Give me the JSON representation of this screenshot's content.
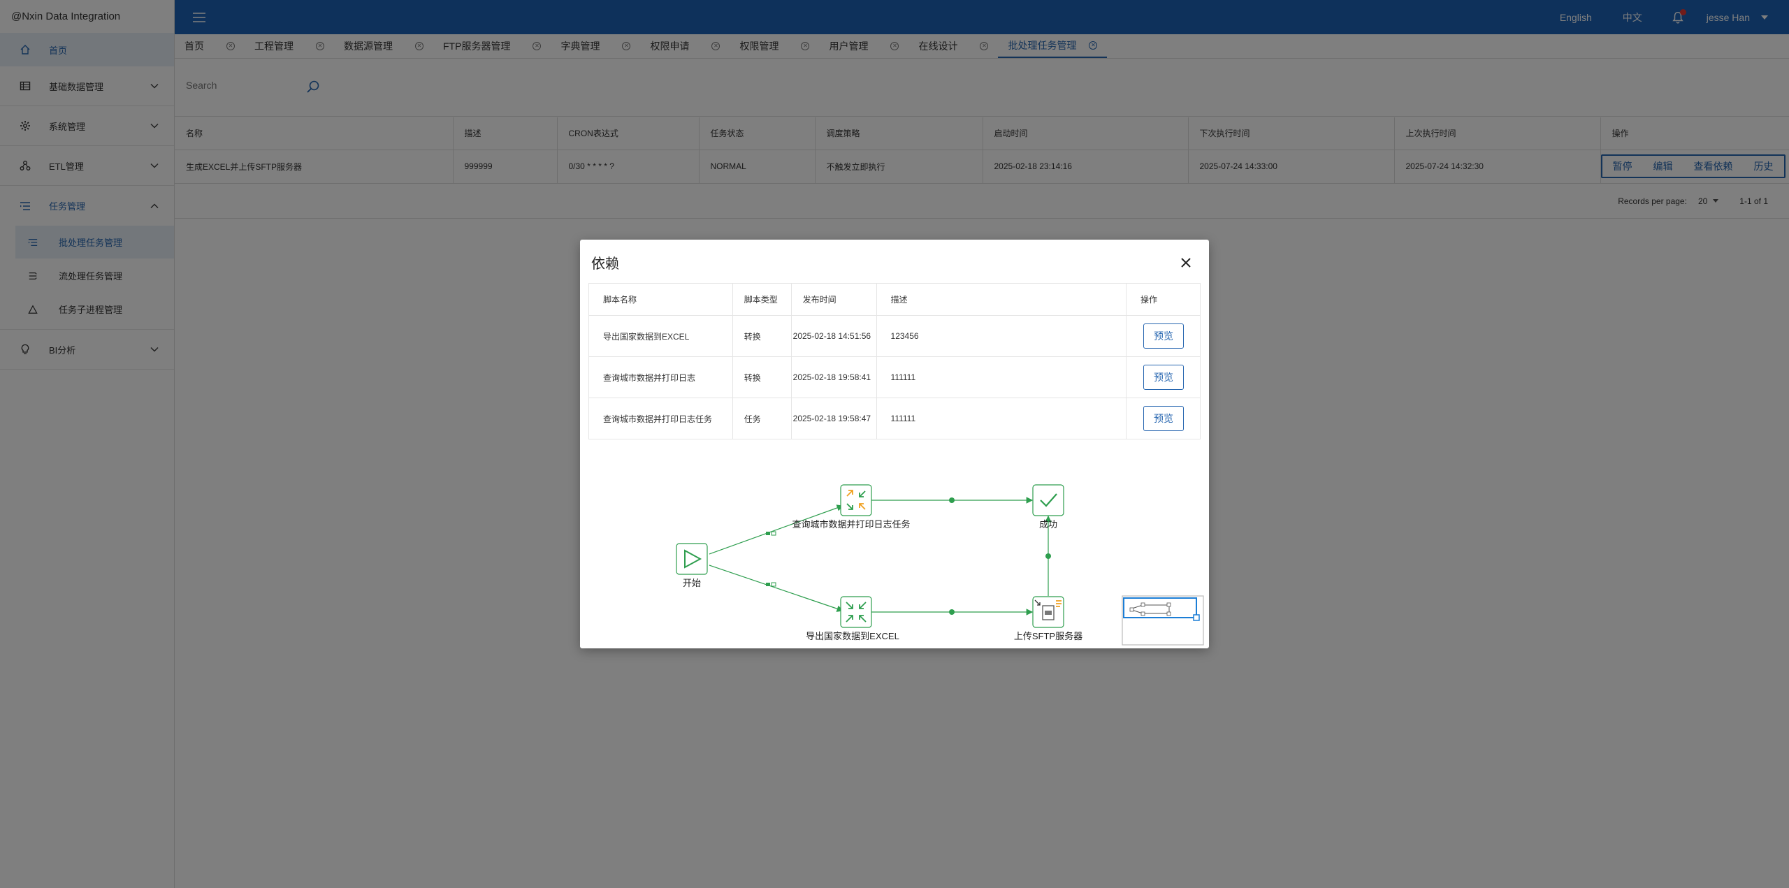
{
  "app": {
    "brand": "@Nxin Data Integration"
  },
  "sidebar": {
    "home": "首页",
    "items": [
      {
        "label": "基础数据管理"
      },
      {
        "label": "系统管理"
      },
      {
        "label": "ETL管理"
      },
      {
        "label": "任务管理"
      },
      {
        "label": "BI分析"
      }
    ],
    "task_sub": [
      {
        "label": "批处理任务管理"
      },
      {
        "label": "流处理任务管理"
      },
      {
        "label": "任务子进程管理"
      }
    ]
  },
  "header": {
    "lang_en": "English",
    "lang_zh": "中文",
    "user": "jesse Han"
  },
  "tabs": [
    {
      "label": "首页"
    },
    {
      "label": "工程管理"
    },
    {
      "label": "数据源管理"
    },
    {
      "label": "FTP服务器管理"
    },
    {
      "label": "字典管理"
    },
    {
      "label": "权限申请"
    },
    {
      "label": "权限管理"
    },
    {
      "label": "用户管理"
    },
    {
      "label": "在线设计"
    },
    {
      "label": "批处理任务管理"
    }
  ],
  "search": {
    "placeholder": "Search"
  },
  "table": {
    "headers": [
      "名称",
      "描述",
      "CRON表达式",
      "任务状态",
      "调度策略",
      "启动时间",
      "下次执行时间",
      "上次执行时间",
      "操作"
    ],
    "row": {
      "name": "生成EXCEL并上传SFTP服务器",
      "desc": "999999",
      "cron": "0/30 * * * * ?",
      "status": "NORMAL",
      "policy": "不触发立即执行",
      "start": "2025-02-18 23:14:16",
      "next": "2025-07-24 14:33:00",
      "last": "2025-07-24 14:32:30",
      "actions": [
        "暂停",
        "编辑",
        "查看依赖",
        "历史"
      ]
    }
  },
  "pager": {
    "label": "Records per page:",
    "per_page": "20",
    "range": "1-1 of 1"
  },
  "modal": {
    "title": "依赖",
    "headers": [
      "脚本名称",
      "脚本类型",
      "发布时间",
      "描述",
      "操作"
    ],
    "rows": [
      {
        "name": "导出国家数据到EXCEL",
        "type": "转换",
        "time": "2025-02-18 14:51:56",
        "desc": "123456",
        "action": "预览"
      },
      {
        "name": "查询城市数据并打印日志",
        "type": "转换",
        "time": "2025-02-18 19:58:41",
        "desc": "111111",
        "action": "预览"
      },
      {
        "name": "查询城市数据并打印日志任务",
        "type": "任务",
        "time": "2025-02-18 19:58:47",
        "desc": "111111",
        "action": "预览"
      }
    ],
    "flow": {
      "start": "开始",
      "top": "查询城市数据并打印日志任务",
      "bottom": "导出国家数据到EXCEL",
      "success": "成功",
      "sftp": "上传SFTP服务器"
    }
  },
  "colors": {
    "primary": "#1c63b7",
    "accent": "#2766b0",
    "flow_green": "#2e9e4e",
    "flow_orange": "#f0a020"
  }
}
